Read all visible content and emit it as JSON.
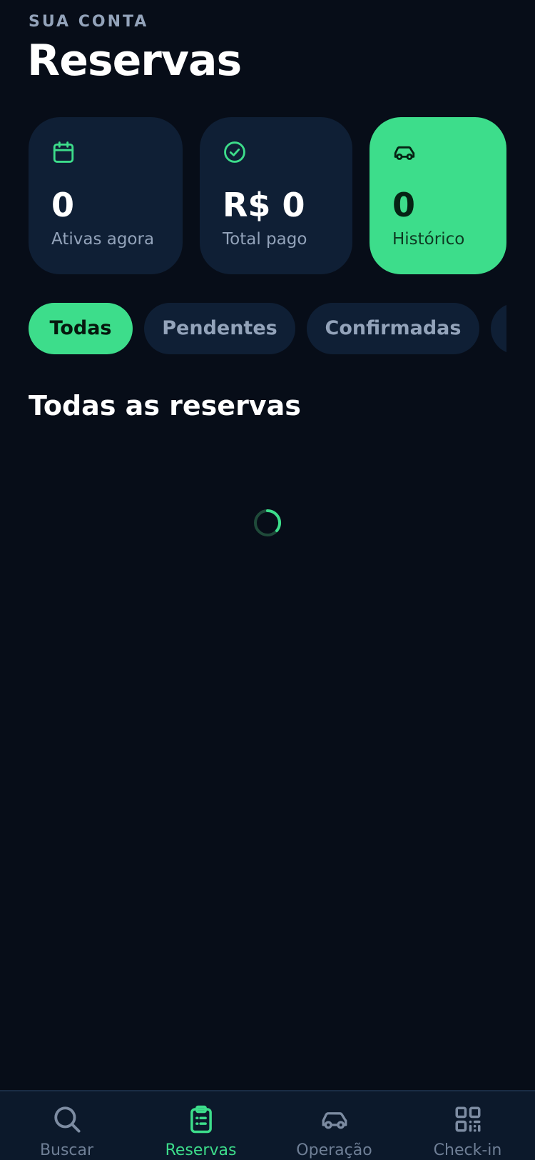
{
  "header": {
    "eyebrow": "SUA CONTA",
    "title": "Reservas"
  },
  "stats": [
    {
      "icon": "calendar-icon",
      "value": "0",
      "label": "Ativas agora"
    },
    {
      "icon": "check-circle-icon",
      "value": "R$ 0",
      "label": "Total pago"
    },
    {
      "icon": "car-icon",
      "value": "0",
      "label": "Histórico"
    }
  ],
  "filters": {
    "items": [
      {
        "label": "Todas",
        "active": true
      },
      {
        "label": "Pendentes",
        "active": false
      },
      {
        "label": "Confirmadas",
        "active": false
      },
      {
        "label": "",
        "active": false
      }
    ]
  },
  "section": {
    "title": "Todas as reservas"
  },
  "nav": {
    "items": [
      {
        "label": "Buscar",
        "icon": "search-icon",
        "active": false
      },
      {
        "label": "Reservas",
        "icon": "clipboard-list-icon",
        "active": true
      },
      {
        "label": "Operação",
        "icon": "car-icon",
        "active": false
      },
      {
        "label": "Check-in",
        "icon": "qr-code-icon",
        "active": false
      }
    ]
  },
  "colors": {
    "background": "#070d18",
    "card": "#0f1f35",
    "accent": "#3ddd8b",
    "muted_text": "#93a3ba"
  }
}
